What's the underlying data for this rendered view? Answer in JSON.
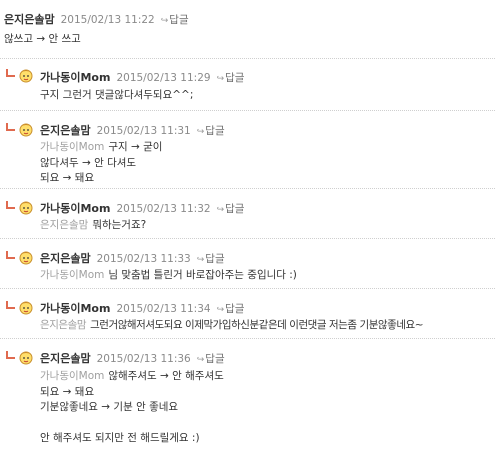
{
  "reply_label": "답글",
  "comments": [
    {
      "nick": "은지은솔맘",
      "date": "2015/02/13 11:22",
      "lines": [
        "않쓰고 → 안 쓰고"
      ]
    },
    {
      "nick": "가나동이Mom",
      "date": "2015/02/13 11:29",
      "lines": [
        "구지 그런거 댓글않다셔두되요^^;"
      ]
    },
    {
      "nick": "은지은솔맘",
      "date": "2015/02/13 11:31",
      "mention": "가나동이Mom",
      "lines": [
        "구지 → 굳이",
        "않다셔두 → 안 다셔도",
        "되요 → 돼요"
      ]
    },
    {
      "nick": "가나동이Mom",
      "date": "2015/02/13 11:32",
      "mention": "은지은솔맘",
      "lines": [
        "뭐하는거죠?"
      ]
    },
    {
      "nick": "은지은솔맘",
      "date": "2015/02/13 11:33",
      "mention": "가나동이Mom",
      "lines": [
        "님 맞춤법 틀린거 바로잡아주는 중입니다 :)"
      ]
    },
    {
      "nick": "가나동이Mom",
      "date": "2015/02/13 11:34",
      "mention": "은지은솔맘",
      "lines": [
        "그런거않해저셔도되요 이제막가입하신분같은데 이런댓글 저는좀 기분않좋네요~"
      ]
    },
    {
      "nick": "은지은솔맘",
      "date": "2015/02/13 11:36",
      "mention": "가나동이Mom",
      "lines": [
        "않해주셔도 → 안 해주셔도",
        "되요 → 돼요",
        "기분않좋네요 → 기분 안 좋네요",
        "",
        "안 해주셔도 되지만 전 해드릴게요 :)"
      ]
    }
  ]
}
